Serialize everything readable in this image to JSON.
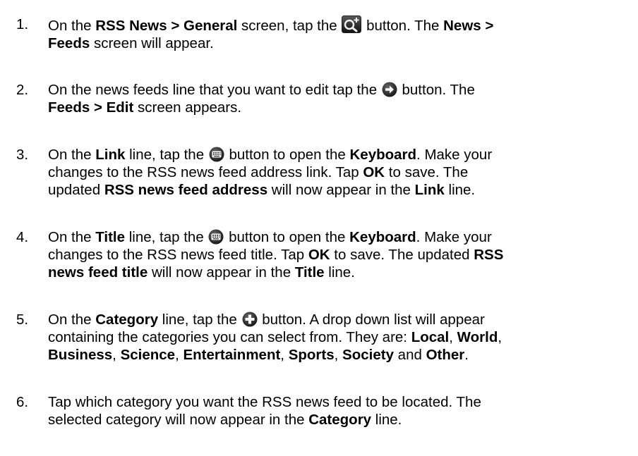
{
  "steps": [
    {
      "number": "1.",
      "lines": [
        [
          {
            "t": "On the "
          },
          {
            "t": "RSS News > General",
            "b": true
          },
          {
            "t": " screen, tap the "
          },
          {
            "icon": "search-plus-icon"
          },
          {
            "t": " button.  The "
          },
          {
            "t": "News >",
            "b": true
          }
        ],
        [
          {
            "t": "Feeds",
            "b": true
          },
          {
            "t": " screen will appear."
          }
        ]
      ]
    },
    {
      "number": "2.",
      "lines": [
        [
          {
            "t": "On the news feeds line that you want to edit tap the "
          },
          {
            "icon": "arrow-right-icon"
          },
          {
            "t": " button.  The"
          }
        ],
        [
          {
            "t": "Feeds > Edit",
            "b": true
          },
          {
            "t": " screen appears."
          }
        ]
      ]
    },
    {
      "number": "3.",
      "lines": [
        [
          {
            "t": "On the "
          },
          {
            "t": "Link",
            "b": true
          },
          {
            "t": " line, tap the "
          },
          {
            "icon": "keyboard-icon"
          },
          {
            "t": " button to open the "
          },
          {
            "t": "Keyboard",
            "b": true
          },
          {
            "t": ".  Make your"
          }
        ],
        [
          {
            "t": "changes to the RSS news feed address link.  Tap "
          },
          {
            "t": "OK",
            "b": true
          },
          {
            "t": " to save.  The"
          }
        ],
        [
          {
            "t": "updated "
          },
          {
            "t": "RSS news feed address",
            "b": true
          },
          {
            "t": " will now appear in the "
          },
          {
            "t": "Link",
            "b": true
          },
          {
            "t": " line."
          }
        ]
      ]
    },
    {
      "number": "4.",
      "lines": [
        [
          {
            "t": "On the "
          },
          {
            "t": "Title",
            "b": true
          },
          {
            "t": " line, tap the "
          },
          {
            "icon": "keyboard-icon"
          },
          {
            "t": " button to open the "
          },
          {
            "t": "Keyboard",
            "b": true
          },
          {
            "t": ".  Make your"
          }
        ],
        [
          {
            "t": "changes to the RSS news feed title.  Tap "
          },
          {
            "t": "OK",
            "b": true
          },
          {
            "t": " to save.  The updated "
          },
          {
            "t": "RSS",
            "b": true
          }
        ],
        [
          {
            "t": "news feed title",
            "b": true
          },
          {
            "t": " will now appear in the "
          },
          {
            "t": "Title",
            "b": true
          },
          {
            "t": " line."
          }
        ]
      ]
    },
    {
      "number": "5.",
      "lines": [
        [
          {
            "t": "On the "
          },
          {
            "t": "Category",
            "b": true
          },
          {
            "t": " line, tap the "
          },
          {
            "icon": "plus-circle-icon"
          },
          {
            "t": " button.  A drop down list will appear"
          }
        ],
        [
          {
            "t": "containing the categories you can select from.  They are:  "
          },
          {
            "t": "Local",
            "b": true
          },
          {
            "t": ", "
          },
          {
            "t": "World",
            "b": true
          },
          {
            "t": ","
          }
        ],
        [
          {
            "t": "Business",
            "b": true
          },
          {
            "t": ", "
          },
          {
            "t": "Science",
            "b": true
          },
          {
            "t": ", "
          },
          {
            "t": "Entertainment",
            "b": true
          },
          {
            "t": ", "
          },
          {
            "t": "Sports",
            "b": true
          },
          {
            "t": ", "
          },
          {
            "t": "Society",
            "b": true
          },
          {
            "t": " and "
          },
          {
            "t": "Other",
            "b": true
          },
          {
            "t": "."
          }
        ]
      ]
    },
    {
      "number": "6.",
      "lines": [
        [
          {
            "t": "Tap which category you want the RSS news feed to be located.  The"
          }
        ],
        [
          {
            "t": "selected category will now appear in the "
          },
          {
            "t": "Category",
            "b": true
          },
          {
            "t": " line."
          }
        ]
      ]
    }
  ]
}
